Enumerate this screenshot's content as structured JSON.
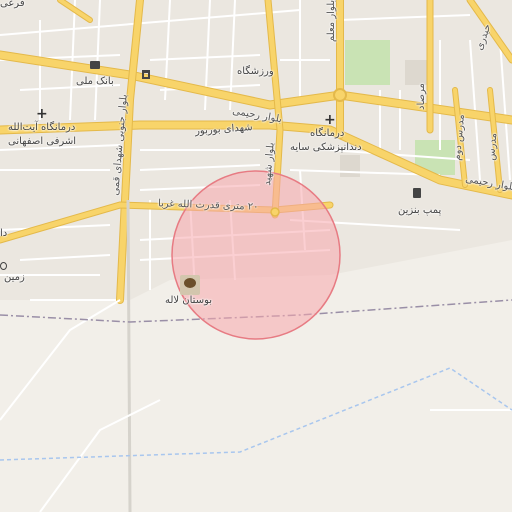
{
  "map": {
    "labels": {
      "bank": "بانک ملی",
      "clinic_ayatollah": "درمانگاه آیت‌الله",
      "clinic_ayatollah_2": "اشرفی اصفهانی",
      "gym": "ورزشگاه",
      "shohada_burbur": "شهدای بوربور",
      "dental_clinic": "درمانگاه",
      "dental_clinic_2": "دندانپزشکی سایه",
      "blvd_rahimi_1": "بلوار رحیمی",
      "blvd_rahimi_2": "بلوار رحیمی",
      "gas_station": "پمپ بنزین",
      "qodrat_street": "۲۰ متری قدرت الله غربا",
      "park": "بوستان لاله",
      "blvd_moallem": "بلوار معلم",
      "blvd_south": "بلوار جنوبی شهدای قمی",
      "blvd_shahid": "بلوار شهید",
      "morsad": "مرصاد",
      "mojahed": "مدرس دوم",
      "modares": "مدرس",
      "heydari": "حیدری",
      "zamin": "زمین",
      "top_left": "فرعی",
      "left_edge": "دا"
    },
    "icons": [
      "bank-icon",
      "shopping-icon",
      "hospital-icon",
      "fuel-icon",
      "tree-icon",
      "roundabout-icon"
    ],
    "colors": {
      "background": "#f2efe9",
      "major_road": "#f8d46a",
      "major_road_casing": "#e4b94a",
      "minor_road": "#ffffff",
      "green": "#c9e3b4",
      "circle_fill": "#f7a8ad",
      "circle_stroke": "#e77b83",
      "boundary": "#9a8fa7",
      "water": "#a8c6ee"
    }
  }
}
